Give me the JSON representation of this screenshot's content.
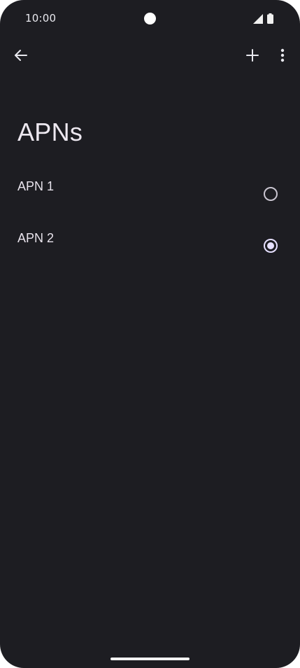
{
  "status_bar": {
    "time": "10:00",
    "icons": [
      "camera-cutout",
      "signal-icon",
      "battery-icon"
    ]
  },
  "app_bar": {
    "back_icon": "arrow-back-icon",
    "add_icon": "plus-icon",
    "more_icon": "more-vert-icon"
  },
  "page": {
    "title": "APNs"
  },
  "apns": [
    {
      "label": "APN 1",
      "selected": false
    },
    {
      "label": "APN 2",
      "selected": true
    }
  ],
  "colors": {
    "background": "#1d1d22",
    "text": "#e8e3ec",
    "radio_selected": "#e6e0ff",
    "radio_unselected": "#c9c5d0"
  }
}
